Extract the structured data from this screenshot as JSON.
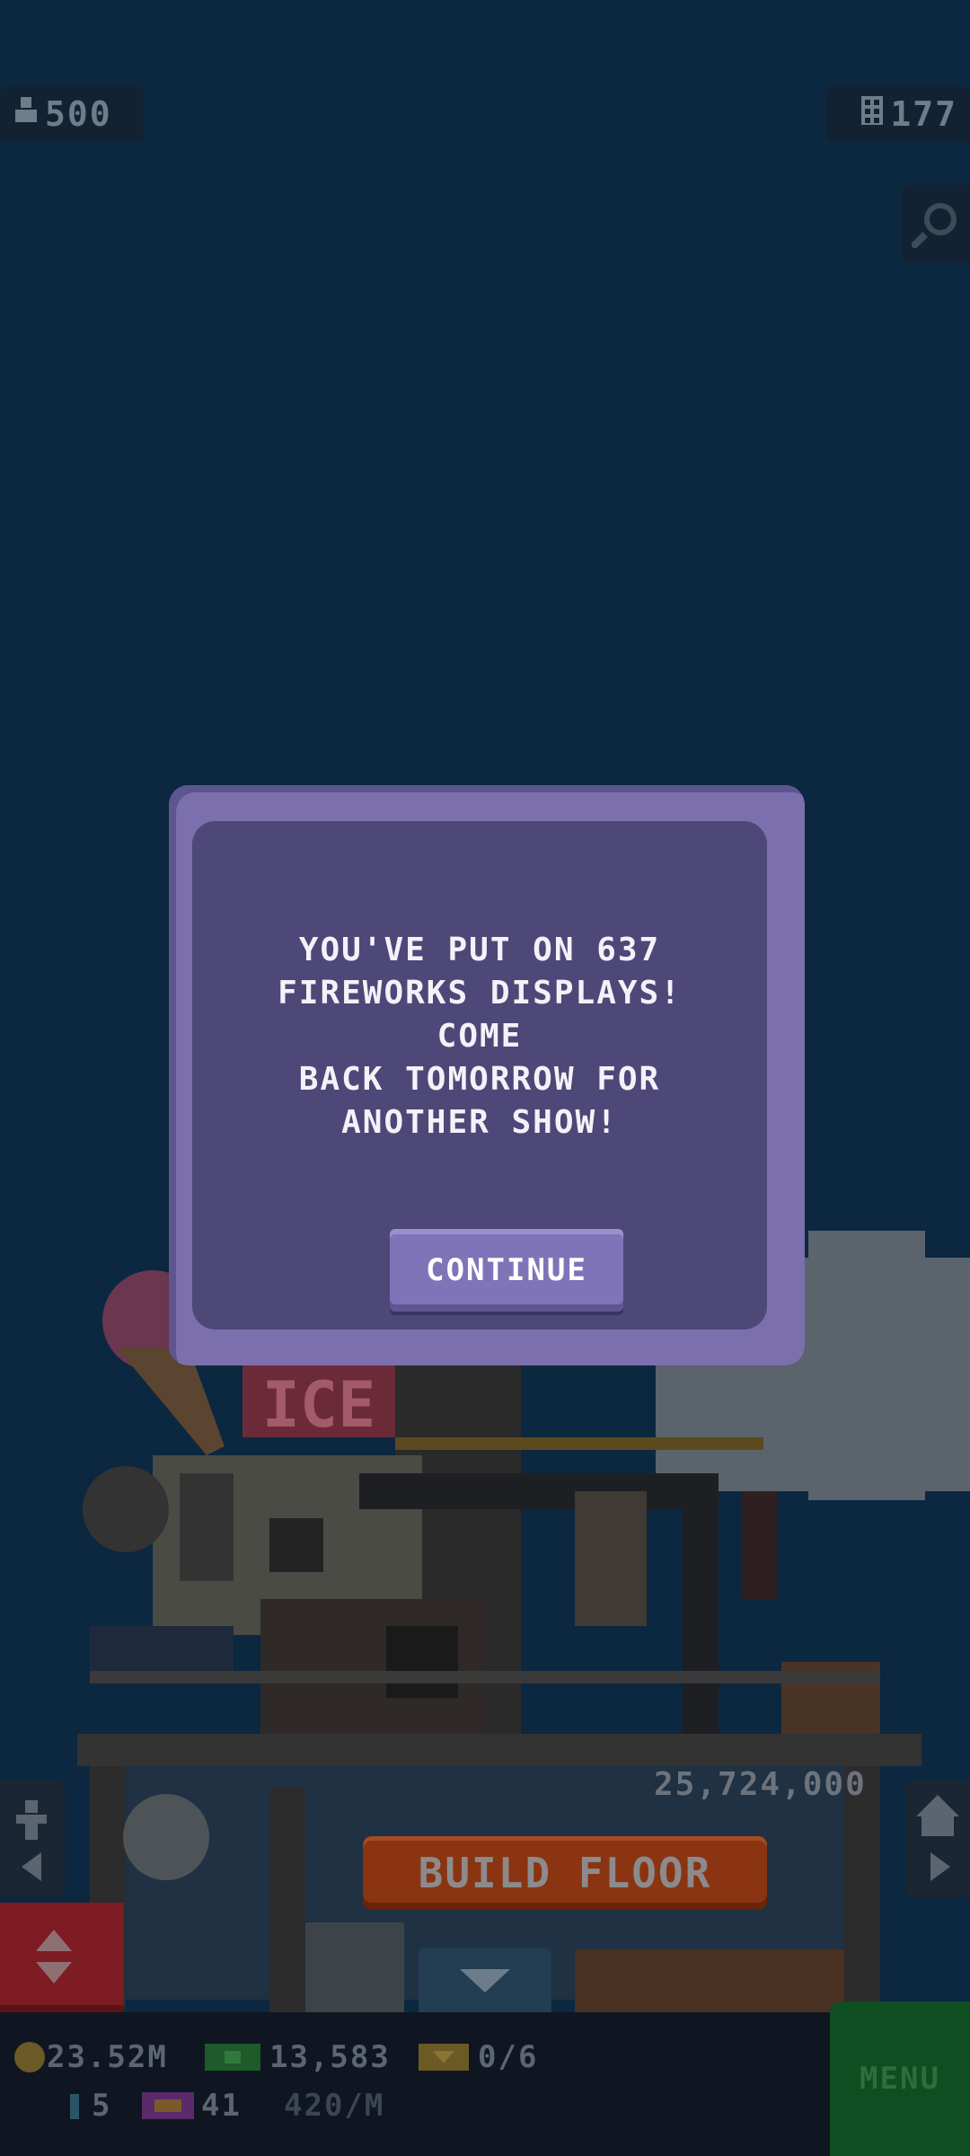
{
  "hud": {
    "population": "500",
    "floors": "177"
  },
  "modal": {
    "message": "YOU'VE PUT ON 637\nFIREWORKS DISPLAYS! COME\nBACK TOMORROW FOR\nANOTHER SHOW!",
    "continue_label": "CONTINUE"
  },
  "building": {
    "sign_text": "ICE",
    "floor_price": "25,724,000",
    "build_floor_label": "BUILD FLOOR"
  },
  "bottom_bar": {
    "coins": "23.52M",
    "bux": "13,583",
    "tickets": "0/6",
    "keys": "5",
    "vip": "41",
    "rate": "420/M",
    "menu_label": "MENU"
  },
  "colors": {
    "background": "#0c2740",
    "modal_outer": "#7b6fae",
    "modal_inner": "#4d4877",
    "build_button": "#8a3412",
    "menu_button": "#0e4e20"
  }
}
